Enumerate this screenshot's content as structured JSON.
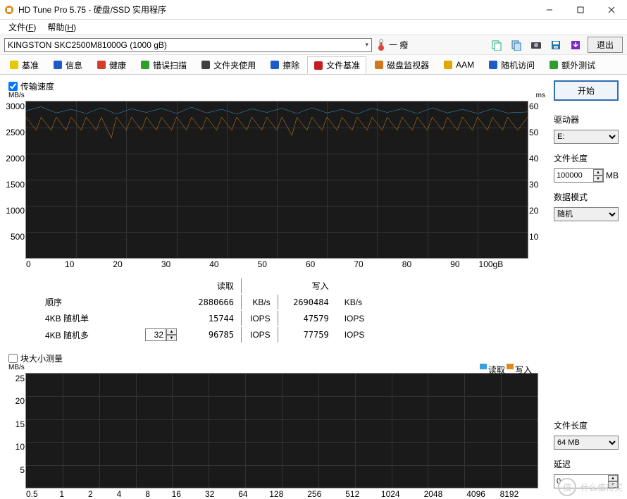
{
  "window": {
    "title": "HD Tune Pro 5.75 - 硬盘/SSD 实用程序"
  },
  "menu": {
    "file": "文件",
    "file_u": "F",
    "help": "帮助",
    "help_u": "H"
  },
  "toolbar": {
    "drive": "KINGSTON SKC2500M81000G (1000 gB)",
    "temp": "一 癈",
    "exit": "退出"
  },
  "tabs": [
    {
      "icon": "#e8c800",
      "label": "基准"
    },
    {
      "icon": "#1e5bc6",
      "label": "信息"
    },
    {
      "icon": "#d43d2a",
      "label": "健康"
    },
    {
      "icon": "#2e9e2e",
      "label": "错误扫描"
    },
    {
      "icon": "#404040",
      "label": "文件夹使用"
    },
    {
      "icon": "#1e5bc6",
      "label": "擦除"
    },
    {
      "icon": "#c41e1e",
      "label": "文件基准",
      "active": true
    },
    {
      "icon": "#d07820",
      "label": "磁盘监视器"
    },
    {
      "icon": "#e0a800",
      "label": "AAM"
    },
    {
      "icon": "#1e5bc6",
      "label": "随机访问"
    },
    {
      "icon": "#2e9e2e",
      "label": "额外测试"
    }
  ],
  "checkboxes": {
    "transfer": "传输速度",
    "blocksize": "块大小测量"
  },
  "side": {
    "start": "开始",
    "drive_label": "驱动器",
    "drive_value": "E:",
    "filelen_label": "文件长度",
    "filelen_value": "100000",
    "filelen_unit": "MB",
    "datamode_label": "数据模式",
    "datamode_value": "随机",
    "filelen2_label": "文件长度",
    "filelen2_value": "64 MB",
    "delay_label": "延迟",
    "delay_value": "0"
  },
  "chart_data": [
    {
      "type": "line",
      "y_unit_left": "MB/s",
      "y_unit_right": "ms",
      "y_ticks_left": [
        "3000",
        "2500",
        "2000",
        "1500",
        "1000",
        "500",
        ""
      ],
      "y_ticks_right": [
        "60",
        "50",
        "40",
        "30",
        "20",
        "10",
        ""
      ],
      "x_ticks": [
        "0",
        "10",
        "20",
        "30",
        "40",
        "50",
        "60",
        "70",
        "80",
        "90",
        "100gB"
      ],
      "ylim_left": [
        0,
        3000
      ],
      "ylim_right": [
        0,
        60
      ],
      "xlim": [
        0,
        100
      ],
      "series": [
        {
          "name": "读取",
          "color": "#3aa0d8",
          "kind": "speed",
          "x": [
            0,
            3,
            6,
            9,
            12,
            15,
            18,
            21,
            24,
            27,
            30,
            33,
            36,
            39,
            42,
            45,
            48,
            51,
            54,
            57,
            60,
            63,
            66,
            69,
            72,
            75,
            78,
            81,
            84,
            87,
            90,
            93,
            96,
            100
          ],
          "y": [
            2820,
            2900,
            2780,
            2850,
            2770,
            2880,
            2760,
            2860,
            2790,
            2870,
            2770,
            2890,
            2780,
            2850,
            2760,
            2860,
            2790,
            2870,
            2770,
            2880,
            2780,
            2850,
            2760,
            2870,
            2790,
            2860,
            2770,
            2880,
            2780,
            2850,
            2770,
            2860,
            2780,
            2800
          ]
        },
        {
          "name": "写入",
          "color": "#e08a1e",
          "kind": "speed",
          "x": [
            0,
            2,
            3,
            5,
            6,
            8,
            9,
            11,
            12,
            14,
            15,
            17,
            18,
            20,
            21,
            23,
            24,
            26,
            27,
            29,
            30,
            32,
            33,
            35,
            36,
            38,
            39,
            41,
            42,
            44,
            45,
            47,
            48,
            50,
            51,
            53,
            54,
            56,
            57,
            59,
            60,
            62,
            63,
            65,
            66,
            68,
            69,
            71,
            72,
            74,
            75,
            77,
            78,
            80,
            81,
            83,
            84,
            86,
            87,
            89,
            90,
            92,
            93,
            95,
            96,
            98,
            100
          ],
          "y": [
            2700,
            2450,
            2700,
            2450,
            2700,
            2450,
            2700,
            2450,
            2700,
            2450,
            2700,
            2300,
            2700,
            2450,
            2700,
            2450,
            2700,
            2450,
            2700,
            2450,
            2700,
            2450,
            2700,
            2450,
            2700,
            2450,
            2700,
            2450,
            2700,
            2450,
            2700,
            2450,
            2700,
            2450,
            2700,
            2350,
            2700,
            2450,
            2700,
            2450,
            2700,
            2450,
            2700,
            2450,
            2700,
            2450,
            2700,
            2450,
            2700,
            2450,
            2700,
            2450,
            2700,
            2450,
            2700,
            2450,
            2700,
            2450,
            2700,
            2450,
            2700,
            2450,
            2700,
            2450,
            2700,
            2450,
            2700
          ]
        }
      ]
    },
    {
      "type": "line",
      "y_unit_left": "MB/s",
      "y_ticks_left": [
        "25",
        "20",
        "15",
        "10",
        "5",
        ""
      ],
      "x_ticks": [
        "0.5",
        "1",
        "2",
        "4",
        "8",
        "16",
        "32",
        "64",
        "128",
        "256",
        "512",
        "1024",
        "2048",
        "4096",
        "8192"
      ],
      "ylim_left": [
        0,
        25
      ],
      "legend": [
        {
          "name": "读取",
          "color": "#3aa0d8"
        },
        {
          "name": "写入",
          "color": "#e08a1e"
        }
      ],
      "series": []
    }
  ],
  "results": {
    "headers": {
      "read": "读取",
      "write": "写入"
    },
    "rows": [
      {
        "label": "顺序",
        "read_val": "2880666",
        "read_unit": "KB/s",
        "write_val": "2690484",
        "write_unit": "KB/s"
      },
      {
        "label": "4KB 随机单",
        "read_val": "15744",
        "read_unit": "IOPS",
        "write_val": "47579",
        "write_unit": "IOPS"
      },
      {
        "label": "4KB 随机多",
        "stepper": "32",
        "read_val": "96785",
        "read_unit": "IOPS",
        "write_val": "77759",
        "write_unit": "IOPS"
      }
    ]
  },
  "watermark": {
    "circle": "值",
    "text": "什么值得买"
  }
}
